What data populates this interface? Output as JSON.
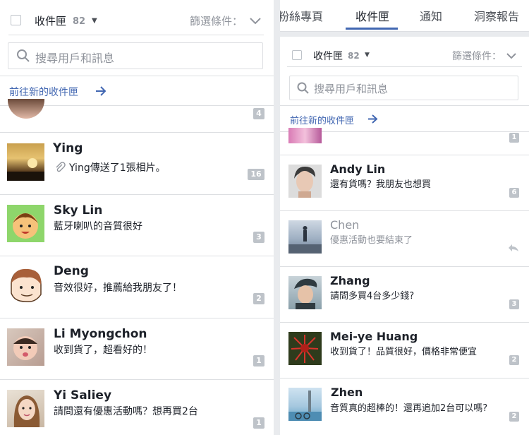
{
  "left": {
    "inbox_label": "收件匣",
    "inbox_count": "82",
    "filter_label": "篩選條件：",
    "search_placeholder": "搜尋用戶和訊息",
    "goto_new_inbox": "前往新的收件匣",
    "partial_badge": "4",
    "conversations": [
      {
        "name": "Ying",
        "snippet": "Ying傳送了1張相片。",
        "badge": "16"
      },
      {
        "name": "Sky Lin",
        "snippet": "藍牙喇叭的音質很好",
        "badge": "3"
      },
      {
        "name": "Deng",
        "snippet": "音效很好，推薦給我朋友了！",
        "badge": "2"
      },
      {
        "name": "Li Myongchon",
        "snippet": "收到貨了，超看好的！",
        "badge": "1"
      },
      {
        "name": "Yi Saliey",
        "snippet": "請問還有優惠活動嗎？想再買2台",
        "badge": "1"
      }
    ]
  },
  "right": {
    "tabs": [
      "粉絲專頁",
      "收件匣",
      "通知",
      "洞察報告"
    ],
    "active_tab": "收件匣",
    "inbox_label": "收件匣",
    "inbox_count": "82",
    "filter_label": "篩選條件：",
    "search_placeholder": "搜尋用戶和訊息",
    "goto_new_inbox": "前往新的收件匣",
    "partial_badge": "1",
    "conversations": [
      {
        "name": "Andy Lin",
        "snippet": "還有貨嗎？我朋友也想買",
        "badge": "6"
      },
      {
        "name": "Chen",
        "snippet": "優惠活動也要結束了",
        "badge": ""
      },
      {
        "name": "Zhang",
        "snippet": "請問多買4台多少錢?",
        "badge": "3"
      },
      {
        "name": "Mei-ye Huang",
        "snippet": "收到貨了！品質很好，價格非常便宜",
        "badge": "2"
      },
      {
        "name": "Zhen",
        "snippet": "音質真的超棒的！還再追加2台可以嗎?",
        "badge": "2"
      }
    ]
  },
  "colors": {
    "accent": "#4267b2",
    "badge": "#bec3c9",
    "muted": "#90949c"
  }
}
